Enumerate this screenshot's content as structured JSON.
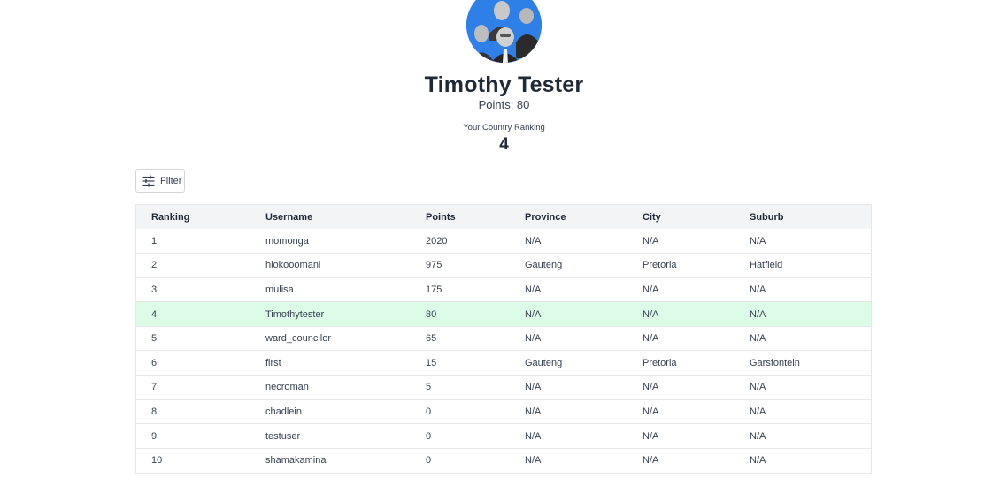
{
  "profile": {
    "name": "Timothy Tester",
    "points_text": "Points: 80",
    "ranking_label": "Your Country Ranking",
    "ranking_value": "4"
  },
  "filter": {
    "label": "Filter",
    "icon": "sliders-icon"
  },
  "leaderboard": {
    "columns": [
      "Ranking",
      "Username",
      "Points",
      "Province",
      "City",
      "Suburb"
    ],
    "highlight_row_color": "#dcfce7",
    "rows": [
      {
        "ranking": "1",
        "username": "momonga",
        "points": "2020",
        "province": "N/A",
        "city": "N/A",
        "suburb": "N/A"
      },
      {
        "ranking": "2",
        "username": "hlokooomani",
        "points": "975",
        "province": "Gauteng",
        "city": "Pretoria",
        "suburb": "Hatfield"
      },
      {
        "ranking": "3",
        "username": "mulisa",
        "points": "175",
        "province": "N/A",
        "city": "N/A",
        "suburb": "N/A"
      },
      {
        "ranking": "4",
        "username": "Timothytester",
        "points": "80",
        "province": "N/A",
        "city": "N/A",
        "suburb": "N/A",
        "current_user": true
      },
      {
        "ranking": "5",
        "username": "ward_councilor",
        "points": "65",
        "province": "N/A",
        "city": "N/A",
        "suburb": "N/A"
      },
      {
        "ranking": "6",
        "username": "first",
        "points": "15",
        "province": "Gauteng",
        "city": "Pretoria",
        "suburb": "Garsfontein"
      },
      {
        "ranking": "7",
        "username": "necroman",
        "points": "5",
        "province": "N/A",
        "city": "N/A",
        "suburb": "N/A"
      },
      {
        "ranking": "8",
        "username": "chadlein",
        "points": "0",
        "province": "N/A",
        "city": "N/A",
        "suburb": "N/A"
      },
      {
        "ranking": "9",
        "username": "testuser",
        "points": "0",
        "province": "N/A",
        "city": "N/A",
        "suburb": "N/A"
      },
      {
        "ranking": "10",
        "username": "shamakamina",
        "points": "0",
        "province": "N/A",
        "city": "N/A",
        "suburb": "N/A"
      }
    ]
  }
}
